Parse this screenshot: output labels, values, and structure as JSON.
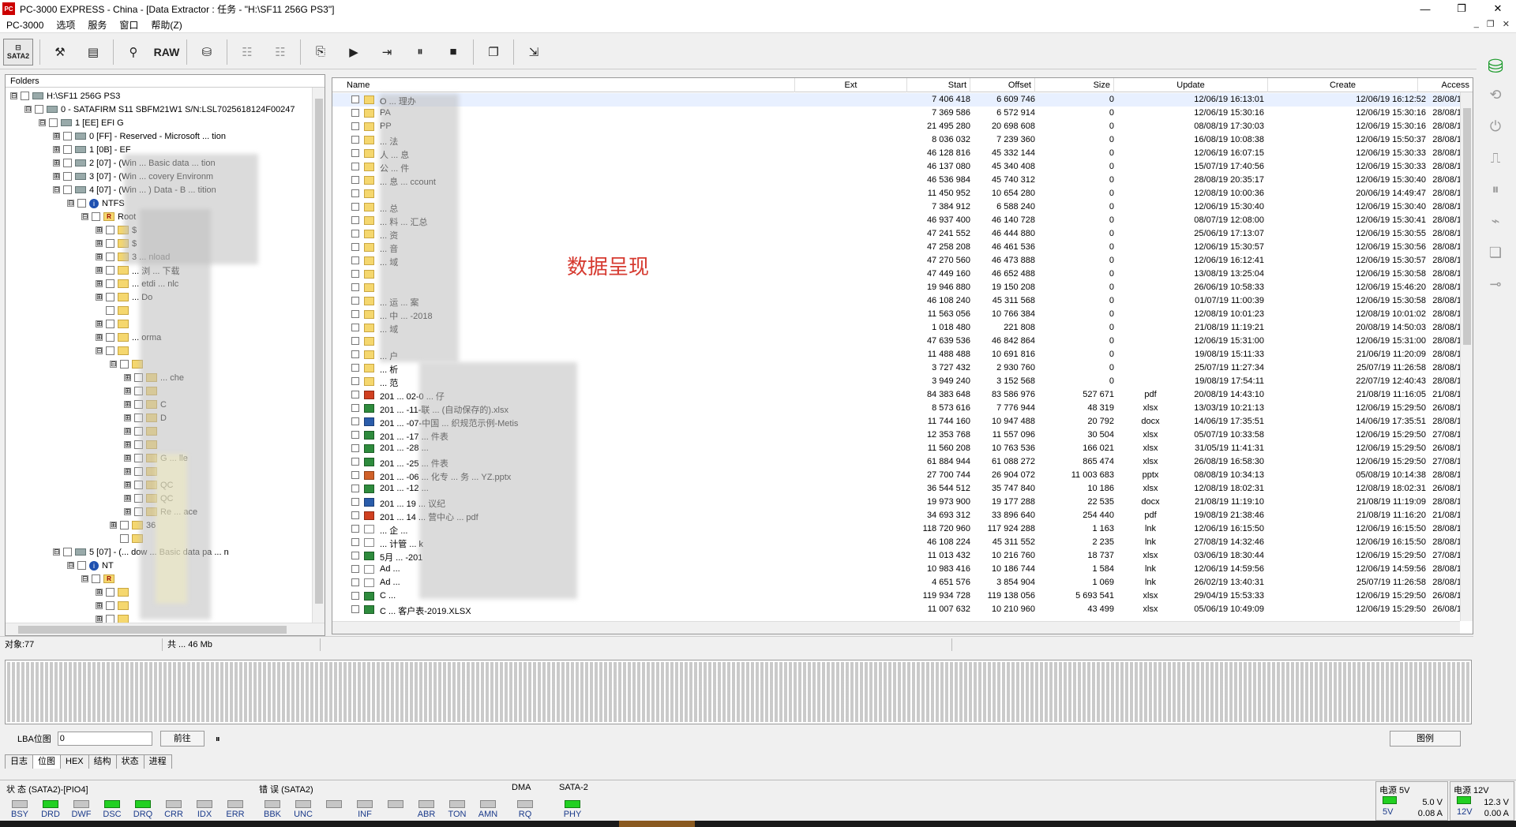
{
  "window": {
    "title": "PC-3000 EXPRESS - China - [Data Extractor : 任务 - \"H:\\SF11 256G PS3\"]",
    "controls": [
      "—",
      "❐",
      "✕"
    ]
  },
  "menu": [
    "PC-3000",
    "选项",
    "服务",
    "窗口",
    "帮助(Z)"
  ],
  "mdi_controls": [
    "_",
    "❐",
    "✕"
  ],
  "toolbar": {
    "sata": "SATA2",
    "raw": "RAW"
  },
  "folders": {
    "header": "Folders",
    "tree": [
      {
        "label": "H:\\SF11 256G PS3",
        "level": 0,
        "exp": "⊟",
        "icon": "disk"
      },
      {
        "label": "0 - SATAFIRM   S11 SBFM21W1 S/N:LSL7025618124F00247",
        "level": 1,
        "exp": "⊟",
        "icon": "disk"
      },
      {
        "label": "1 [EE] EFI G",
        "level": 2,
        "exp": "⊟",
        "icon": "disk"
      },
      {
        "label": "0 [FF] - Reserved - Microsoft ... tion",
        "level": 3,
        "exp": "⊞",
        "icon": "disk"
      },
      {
        "label": "1 [0B] - EF",
        "level": 3,
        "exp": "⊞",
        "icon": "disk"
      },
      {
        "label": "2 [07] - (Win ... Basic data ... tion",
        "level": 3,
        "exp": "⊞",
        "icon": "disk"
      },
      {
        "label": "3 [07] - (Win ... covery Environm",
        "level": 3,
        "exp": "⊞",
        "icon": "disk"
      },
      {
        "label": "4 [07] - (Win ... ) Data - B ... tition",
        "level": 3,
        "exp": "⊟",
        "icon": "disk"
      },
      {
        "label": "NTFS",
        "level": 4,
        "exp": "⊟",
        "icon": "info"
      },
      {
        "label": "Root",
        "level": 5,
        "exp": "⊟",
        "icon": "root"
      },
      {
        "label": "$",
        "level": 6,
        "exp": "⊞",
        "icon": "folder"
      },
      {
        "label": "$",
        "level": 6,
        "exp": "⊞",
        "icon": "folder"
      },
      {
        "label": "3 ... nload",
        "level": 6,
        "exp": "⊞",
        "icon": "folder"
      },
      {
        "label": "... 浏 ... 下载",
        "level": 6,
        "exp": "⊞",
        "icon": "folder"
      },
      {
        "label": "... etdi ... nlc",
        "level": 6,
        "exp": "⊞",
        "icon": "folder"
      },
      {
        "label": "... Do",
        "level": 6,
        "exp": "⊞",
        "icon": "folder"
      },
      {
        "label": "",
        "level": 6,
        "exp": "",
        "icon": "folder"
      },
      {
        "label": "",
        "level": 6,
        "exp": "⊞",
        "icon": "folder"
      },
      {
        "label": "... orma",
        "level": 6,
        "exp": "⊞",
        "icon": "folder"
      },
      {
        "label": "",
        "level": 6,
        "exp": "⊟",
        "icon": "folder"
      },
      {
        "label": "",
        "level": 7,
        "exp": "⊟",
        "icon": "folder"
      },
      {
        "label": "... che",
        "level": 8,
        "exp": "⊞",
        "icon": "folder"
      },
      {
        "label": "",
        "level": 8,
        "exp": "⊞",
        "icon": "folder"
      },
      {
        "label": "C",
        "level": 8,
        "exp": "⊞",
        "icon": "folder"
      },
      {
        "label": "D",
        "level": 8,
        "exp": "⊞",
        "icon": "folder"
      },
      {
        "label": "",
        "level": 8,
        "exp": "⊞",
        "icon": "folder"
      },
      {
        "label": "",
        "level": 8,
        "exp": "⊞",
        "icon": "folder"
      },
      {
        "label": "G ... lle",
        "level": 8,
        "exp": "⊞",
        "icon": "folder"
      },
      {
        "label": "",
        "level": 8,
        "exp": "⊞",
        "icon": "folder"
      },
      {
        "label": "QC",
        "level": 8,
        "exp": "⊞",
        "icon": "folder"
      },
      {
        "label": "QC",
        "level": 8,
        "exp": "⊞",
        "icon": "folder"
      },
      {
        "label": "Re ... ace",
        "level": 8,
        "exp": "⊞",
        "icon": "folder"
      },
      {
        "label": "36",
        "level": 7,
        "exp": "⊞",
        "icon": "folder"
      },
      {
        "label": "",
        "level": 7,
        "exp": "",
        "icon": "folder"
      },
      {
        "label": "5 [07] - (... dow ... Basic data pa ... n",
        "level": 3,
        "exp": "⊟",
        "icon": "disk"
      },
      {
        "label": "NT",
        "level": 4,
        "exp": "⊟",
        "icon": "info"
      },
      {
        "label": "",
        "level": 5,
        "exp": "⊟",
        "icon": "root"
      },
      {
        "label": "",
        "level": 6,
        "exp": "⊞",
        "icon": "folder"
      },
      {
        "label": "",
        "level": 6,
        "exp": "⊞",
        "icon": "folder"
      },
      {
        "label": "",
        "level": 6,
        "exp": "⊞",
        "icon": "folder"
      }
    ]
  },
  "filelist": {
    "columns": [
      "Name",
      "Ext",
      "Start",
      "Offset",
      "Size",
      "Update",
      "Create",
      "Access"
    ],
    "rows": [
      {
        "name": "O ... 理办",
        "ext": "",
        "start": "7 406 418",
        "offset": "6 609 746",
        "size": "0",
        "update": "12/06/19 16:13:01",
        "create": "12/06/19 16:12:52",
        "access": "28/08/1",
        "icon": "folder"
      },
      {
        "name": "PA",
        "ext": "",
        "start": "7 369 586",
        "offset": "6 572 914",
        "size": "0",
        "update": "12/06/19 15:30:16",
        "create": "12/06/19 15:30:16",
        "access": "28/08/1",
        "icon": "folder"
      },
      {
        "name": "PP",
        "ext": "",
        "start": "21 495 280",
        "offset": "20 698 608",
        "size": "0",
        "update": "08/08/19 17:30:03",
        "create": "12/06/19 15:30:16",
        "access": "28/08/1",
        "icon": "folder"
      },
      {
        "name": "... 法",
        "ext": "",
        "start": "8 036 032",
        "offset": "7 239 360",
        "size": "0",
        "update": "16/08/19 10:08:38",
        "create": "12/06/19 15:50:37",
        "access": "28/08/1",
        "icon": "folder"
      },
      {
        "name": "人 ... 息",
        "ext": "",
        "start": "46 128 816",
        "offset": "45 332 144",
        "size": "0",
        "update": "12/06/19 16:07:15",
        "create": "12/06/19 15:30:33",
        "access": "28/08/1",
        "icon": "folder"
      },
      {
        "name": "公 ... 件",
        "ext": "",
        "start": "46 137 080",
        "offset": "45 340 408",
        "size": "0",
        "update": "15/07/19 17:40:56",
        "create": "12/06/19 15:30:33",
        "access": "28/08/1",
        "icon": "folder"
      },
      {
        "name": "... 息 ... ccount",
        "ext": "",
        "start": "46 536 984",
        "offset": "45 740 312",
        "size": "0",
        "update": "28/08/19 20:35:17",
        "create": "12/06/19 15:30:40",
        "access": "28/08/1",
        "icon": "folder"
      },
      {
        "name": "",
        "ext": "",
        "start": "11 450 952",
        "offset": "10 654 280",
        "size": "0",
        "update": "12/08/19 10:00:36",
        "create": "20/06/19 14:49:47",
        "access": "28/08/1",
        "icon": "folder"
      },
      {
        "name": "... 总",
        "ext": "",
        "start": "7 384 912",
        "offset": "6 588 240",
        "size": "0",
        "update": "12/06/19 15:30:40",
        "create": "12/06/19 15:30:40",
        "access": "28/08/1",
        "icon": "folder"
      },
      {
        "name": "... 料 ... 汇总",
        "ext": "",
        "start": "46 937 400",
        "offset": "46 140 728",
        "size": "0",
        "update": "08/07/19 12:08:00",
        "create": "12/06/19 15:30:41",
        "access": "28/08/1",
        "icon": "folder"
      },
      {
        "name": "... 资",
        "ext": "",
        "start": "47 241 552",
        "offset": "46 444 880",
        "size": "0",
        "update": "25/06/19 17:13:07",
        "create": "12/06/19 15:30:55",
        "access": "28/08/1",
        "icon": "folder"
      },
      {
        "name": "... 音",
        "ext": "",
        "start": "47 258 208",
        "offset": "46 461 536",
        "size": "0",
        "update": "12/06/19 15:30:57",
        "create": "12/06/19 15:30:56",
        "access": "28/08/1",
        "icon": "folder"
      },
      {
        "name": "... 域",
        "ext": "",
        "start": "47 270 560",
        "offset": "46 473 888",
        "size": "0",
        "update": "12/06/19 16:12:41",
        "create": "12/06/19 15:30:57",
        "access": "28/08/1",
        "icon": "folder"
      },
      {
        "name": "",
        "ext": "",
        "start": "47 449 160",
        "offset": "46 652 488",
        "size": "0",
        "update": "13/08/19 13:25:04",
        "create": "12/06/19 15:30:58",
        "access": "28/08/1",
        "icon": "folder"
      },
      {
        "name": "",
        "ext": "",
        "start": "19 946 880",
        "offset": "19 150 208",
        "size": "0",
        "update": "26/06/19 10:58:33",
        "create": "12/06/19 15:46:20",
        "access": "28/08/1",
        "icon": "folder"
      },
      {
        "name": "... 运 ... 案",
        "ext": "",
        "start": "46 108 240",
        "offset": "45 311 568",
        "size": "0",
        "update": "01/07/19 11:00:39",
        "create": "12/06/19 15:30:58",
        "access": "28/08/1",
        "icon": "folder"
      },
      {
        "name": "... 中 ... -2018",
        "ext": "",
        "start": "11 563 056",
        "offset": "10 766 384",
        "size": "0",
        "update": "12/08/19 10:01:23",
        "create": "12/08/19 10:01:02",
        "access": "28/08/1",
        "icon": "folder"
      },
      {
        "name": "... 域",
        "ext": "",
        "start": "1 018 480",
        "offset": "221 808",
        "size": "0",
        "update": "21/08/19 11:19:21",
        "create": "20/08/19 14:50:03",
        "access": "28/08/1",
        "icon": "folder"
      },
      {
        "name": "",
        "ext": "",
        "start": "47 639 536",
        "offset": "46 842 864",
        "size": "0",
        "update": "12/06/19 15:31:00",
        "create": "12/06/19 15:31:00",
        "access": "28/08/1",
        "icon": "folder"
      },
      {
        "name": "... 户",
        "ext": "",
        "start": "11 488 488",
        "offset": "10 691 816",
        "size": "0",
        "update": "19/08/19 15:11:33",
        "create": "21/06/19 11:20:09",
        "access": "28/08/1",
        "icon": "folder"
      },
      {
        "name": "... 析",
        "ext": "",
        "start": "3 727 432",
        "offset": "2 930 760",
        "size": "0",
        "update": "25/07/19 11:27:34",
        "create": "25/07/19 11:26:58",
        "access": "28/08/1",
        "icon": "folder"
      },
      {
        "name": "... 范",
        "ext": "",
        "start": "3 949 240",
        "offset": "3 152 568",
        "size": "0",
        "update": "19/08/19 17:54:11",
        "create": "22/07/19 12:40:43",
        "access": "28/08/1",
        "icon": "folder"
      },
      {
        "name": "201 ... 02-0 ... 仔",
        "ext": "pdf",
        "start": "84 383 648",
        "offset": "83 586 976",
        "size": "527 671",
        "update": "20/08/19 14:43:10",
        "create": "21/08/19 11:16:05",
        "access": "21/08/1",
        "icon": "pdf"
      },
      {
        "name": "201 ... -11-联 ... (自动保存的).xlsx",
        "ext": "xlsx",
        "start": "8 573 616",
        "offset": "7 776 944",
        "size": "48 319",
        "update": "13/03/19 10:21:13",
        "create": "12/06/19 15:29:50",
        "access": "26/08/1",
        "icon": "xlsx"
      },
      {
        "name": "201 ... -07-中国 ... 织规范示例-Metis",
        "ext": "docx",
        "start": "11 744 160",
        "offset": "10 947 488",
        "size": "20 792",
        "update": "14/06/19 17:35:51",
        "create": "14/06/19 17:35:51",
        "access": "28/08/1",
        "icon": "docx"
      },
      {
        "name": "201 ... -17 ... 件表",
        "ext": "xlsx",
        "start": "12 353 768",
        "offset": "11 557 096",
        "size": "30 504",
        "update": "05/07/19 10:33:58",
        "create": "12/06/19 15:29:50",
        "access": "27/08/1",
        "icon": "xlsx"
      },
      {
        "name": "201 ... -28 ...",
        "ext": "xlsx",
        "start": "11 560 208",
        "offset": "10 763 536",
        "size": "166 021",
        "update": "31/05/19 11:41:31",
        "create": "12/06/19 15:29:50",
        "access": "26/08/1",
        "icon": "xlsx"
      },
      {
        "name": "201 ... -25 ... 件表",
        "ext": "xlsx",
        "start": "61 884 944",
        "offset": "61 088 272",
        "size": "865 474",
        "update": "26/08/19 16:58:30",
        "create": "12/06/19 15:29:50",
        "access": "27/08/1",
        "icon": "xlsx"
      },
      {
        "name": "201 ... -06 ... 化专 ... 务 ... YZ.pptx",
        "ext": "pptx",
        "start": "27 700 744",
        "offset": "26 904 072",
        "size": "11 003 683",
        "update": "08/08/19 10:34:13",
        "create": "05/08/19 10:14:38",
        "access": "28/08/1",
        "icon": "pptx"
      },
      {
        "name": "201 ... -12 ...",
        "ext": "xlsx",
        "start": "36 544 512",
        "offset": "35 747 840",
        "size": "10 186",
        "update": "12/08/19 18:02:31",
        "create": "12/08/19 18:02:31",
        "access": "26/08/1",
        "icon": "xlsx"
      },
      {
        "name": "201 ... 19 ... 议纪",
        "ext": "docx",
        "start": "19 973 900",
        "offset": "19 177 288",
        "size": "22 535",
        "update": "21/08/19 11:19:10",
        "create": "21/08/19 11:19:09",
        "access": "28/08/1",
        "icon": "docx"
      },
      {
        "name": "201 ... 14 ... 营中心 ... pdf",
        "ext": "pdf",
        "start": "34 693 312",
        "offset": "33 896 640",
        "size": "254 440",
        "update": "19/08/19 21:38:46",
        "create": "21/08/19 11:16:20",
        "access": "21/08/1",
        "icon": "pdf"
      },
      {
        "name": "... 企 ...",
        "ext": "lnk",
        "start": "118 720 960",
        "offset": "117 924 288",
        "size": "1 163",
        "update": "12/06/19 16:15:50",
        "create": "12/06/19 16:15:50",
        "access": "28/08/1",
        "icon": "lnk"
      },
      {
        "name": "... 计管 ... k",
        "ext": "lnk",
        "start": "46 108 224",
        "offset": "45 311 552",
        "size": "2 235",
        "update": "27/08/19 14:32:46",
        "create": "12/06/19 16:15:50",
        "access": "28/08/1",
        "icon": "lnk"
      },
      {
        "name": "5月 ... -201",
        "ext": "xlsx",
        "start": "11 013 432",
        "offset": "10 216 760",
        "size": "18 737",
        "update": "03/06/19 18:30:44",
        "create": "12/06/19 15:29:50",
        "access": "27/08/1",
        "icon": "xlsx"
      },
      {
        "name": "Ad ...",
        "ext": "lnk",
        "start": "10 983 416",
        "offset": "10 186 744",
        "size": "1 584",
        "update": "12/06/19 14:59:56",
        "create": "12/06/19 14:59:56",
        "access": "28/08/1",
        "icon": "lnk"
      },
      {
        "name": "Ad ...",
        "ext": "lnk",
        "start": "4 651 576",
        "offset": "3 854 904",
        "size": "1 069",
        "update": "26/02/19 13:40:31",
        "create": "25/07/19 11:26:58",
        "access": "28/08/1",
        "icon": "lnk"
      },
      {
        "name": "C ...",
        "ext": "xlsx",
        "start": "119 934 728",
        "offset": "119 138 056",
        "size": "5 693 541",
        "update": "29/04/19 15:53:33",
        "create": "12/06/19 15:29:50",
        "access": "26/08/1",
        "icon": "xlsx"
      },
      {
        "name": "C ... 客户表-2019.XLSX",
        "ext": "xlsx",
        "start": "11 007 632",
        "offset": "10 210 960",
        "size": "43 499",
        "update": "05/06/19 10:49:09",
        "create": "12/06/19 15:29:50",
        "access": "26/08/1",
        "icon": "xlsx"
      }
    ]
  },
  "overlay_text": "数据呈现",
  "status": {
    "objects": "对象:77",
    "total": "共 ... 46 Mb"
  },
  "lba": {
    "label": "LBA位图",
    "value": "0",
    "go": "前往",
    "pause": "⏸",
    "legend": "图例"
  },
  "tabs": [
    "日志",
    "位图",
    "HEX",
    "结构",
    "状态",
    "进程"
  ],
  "leds": {
    "status_title": "状 态 (SATA2)-[PIO4]",
    "status": [
      {
        "n": "BSY",
        "on": false
      },
      {
        "n": "DRD",
        "on": true
      },
      {
        "n": "DWF",
        "on": false
      },
      {
        "n": "DSC",
        "on": true
      },
      {
        "n": "DRQ",
        "on": true
      },
      {
        "n": "CRR",
        "on": false
      },
      {
        "n": "IDX",
        "on": false
      },
      {
        "n": "ERR",
        "on": false
      }
    ],
    "error_title": "错 误 (SATA2)",
    "errors": [
      {
        "n": "BBK",
        "on": false
      },
      {
        "n": "UNC",
        "on": false
      },
      {
        "n": "",
        "on": false
      },
      {
        "n": "INF",
        "on": false
      },
      {
        "n": "",
        "on": false
      },
      {
        "n": "ABR",
        "on": false
      },
      {
        "n": "TON",
        "on": false
      },
      {
        "n": "AMN",
        "on": false
      }
    ],
    "dma_title": "DMA",
    "dma": [
      {
        "n": "RQ",
        "on": false
      }
    ],
    "sata_title": "SATA-2",
    "sata": [
      {
        "n": "PHY",
        "on": true
      }
    ]
  },
  "power": {
    "p5": {
      "title": "电源 5V",
      "label": "5V",
      "volt": "5.0 V",
      "amp": "0.08 A"
    },
    "p12": {
      "title": "电源 12V",
      "label": "12V",
      "volt": "12.3 V",
      "amp": "0.00 A"
    }
  }
}
